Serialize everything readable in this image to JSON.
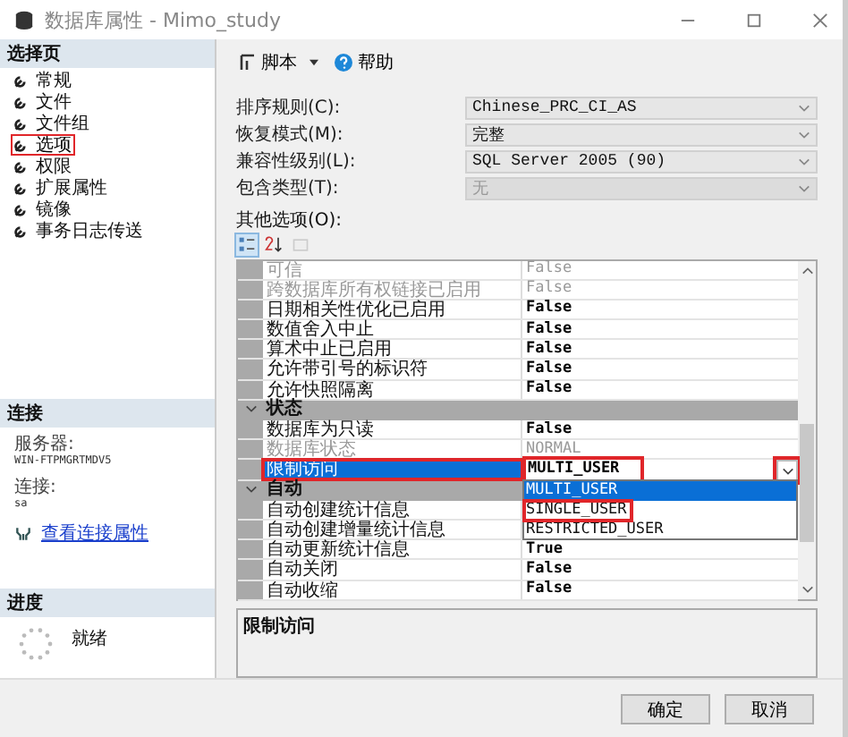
{
  "window": {
    "title": "数据库属性 - Mimo_study"
  },
  "sidebar": {
    "header": "选择页",
    "items": [
      {
        "label": "常规",
        "selected": false,
        "highlighted": false
      },
      {
        "label": "文件",
        "selected": false,
        "highlighted": false
      },
      {
        "label": "文件组",
        "selected": false,
        "highlighted": false
      },
      {
        "label": "选项",
        "selected": true,
        "highlighted": true
      },
      {
        "label": "权限",
        "selected": false,
        "highlighted": false
      },
      {
        "label": "扩展属性",
        "selected": false,
        "highlighted": false
      },
      {
        "label": "镜像",
        "selected": false,
        "highlighted": false
      },
      {
        "label": "事务日志传送",
        "selected": false,
        "highlighted": false
      }
    ]
  },
  "connection": {
    "header": "连接",
    "server_label": "服务器:",
    "server": "WIN-FTPMGRTMDV5",
    "connection_label": "连接:",
    "connection": "sa",
    "link": "查看连接属性"
  },
  "progress": {
    "header": "进度",
    "status": "就绪"
  },
  "toolbar": {
    "script": "脚本",
    "help": "帮助"
  },
  "fields": [
    {
      "label": "排序规则(C):",
      "value": "Chinese_PRC_CI_AS",
      "disabled": false
    },
    {
      "label": "恢复模式(M):",
      "value": "完整",
      "disabled": false
    },
    {
      "label": "兼容性级别(L):",
      "value": "SQL Server 2005 (90)",
      "disabled": false
    },
    {
      "label": "包含类型(T):",
      "value": "无",
      "disabled": true
    }
  ],
  "other_options_label": "其他选项(O):",
  "grid_toolbar": [
    {
      "kind": "categorized",
      "selected": true,
      "disabled": false
    },
    {
      "kind": "alphabetical",
      "selected": false,
      "disabled": false
    },
    {
      "kind": "pages",
      "selected": false,
      "disabled": true
    }
  ],
  "grid_rows": [
    {
      "kind": "property",
      "name": "可信",
      "value": "False",
      "bold": false,
      "disabled": true,
      "selected": false,
      "highlighted": false
    },
    {
      "kind": "property",
      "name": "跨数据库所有权链接已启用",
      "value": "False",
      "bold": false,
      "disabled": true,
      "selected": false,
      "highlighted": false
    },
    {
      "kind": "property",
      "name": "日期相关性优化已启用",
      "value": "False",
      "bold": true,
      "disabled": false,
      "selected": false,
      "highlighted": false
    },
    {
      "kind": "property",
      "name": "数值舍入中止",
      "value": "False",
      "bold": true,
      "disabled": false,
      "selected": false,
      "highlighted": false
    },
    {
      "kind": "property",
      "name": "算术中止已启用",
      "value": "False",
      "bold": true,
      "disabled": false,
      "selected": false,
      "highlighted": false
    },
    {
      "kind": "property",
      "name": "允许带引号的标识符",
      "value": "False",
      "bold": true,
      "disabled": false,
      "selected": false,
      "highlighted": false
    },
    {
      "kind": "property",
      "name": "允许快照隔离",
      "value": "False",
      "bold": true,
      "disabled": false,
      "selected": false,
      "highlighted": false
    },
    {
      "kind": "category",
      "name": "状态",
      "expanded": true
    },
    {
      "kind": "property",
      "name": "数据库为只读",
      "value": "False",
      "bold": true,
      "disabled": false,
      "selected": false,
      "highlighted": false
    },
    {
      "kind": "property",
      "name": "数据库状态",
      "value": "NORMAL",
      "bold": false,
      "disabled": true,
      "selected": false,
      "highlighted": false
    },
    {
      "kind": "property",
      "name": "限制访问",
      "value": "MULTI_USER",
      "bold": true,
      "disabled": false,
      "selected": true,
      "highlighted": true,
      "dropdown": {
        "button_highlighted": true,
        "options": [
          {
            "label": "MULTI_USER",
            "selected": true,
            "highlighted": false
          },
          {
            "label": "SINGLE_USER",
            "selected": false,
            "highlighted": true
          },
          {
            "label": "RESTRICTED_USER",
            "selected": false,
            "highlighted": false
          }
        ]
      }
    },
    {
      "kind": "category",
      "name": "自动",
      "expanded": true
    },
    {
      "kind": "property",
      "name": "自动创建统计信息",
      "disabled": false,
      "selected": false,
      "highlighted": false
    },
    {
      "kind": "property",
      "name": "自动创建增量统计信息",
      "disabled": false,
      "selected": false,
      "highlighted": false
    },
    {
      "kind": "property",
      "name": "自动更新统计信息",
      "value": "True",
      "bold": true,
      "disabled": false,
      "selected": false,
      "highlighted": false
    },
    {
      "kind": "property",
      "name": "自动关闭",
      "value": "False",
      "bold": true,
      "disabled": false,
      "selected": false,
      "highlighted": false
    },
    {
      "kind": "property",
      "name": "自动收缩",
      "value": "False",
      "bold": true,
      "disabled": false,
      "selected": false,
      "highlighted": false
    }
  ],
  "description": {
    "title": "限制访问"
  },
  "buttons": [
    "确定",
    "取消"
  ]
}
